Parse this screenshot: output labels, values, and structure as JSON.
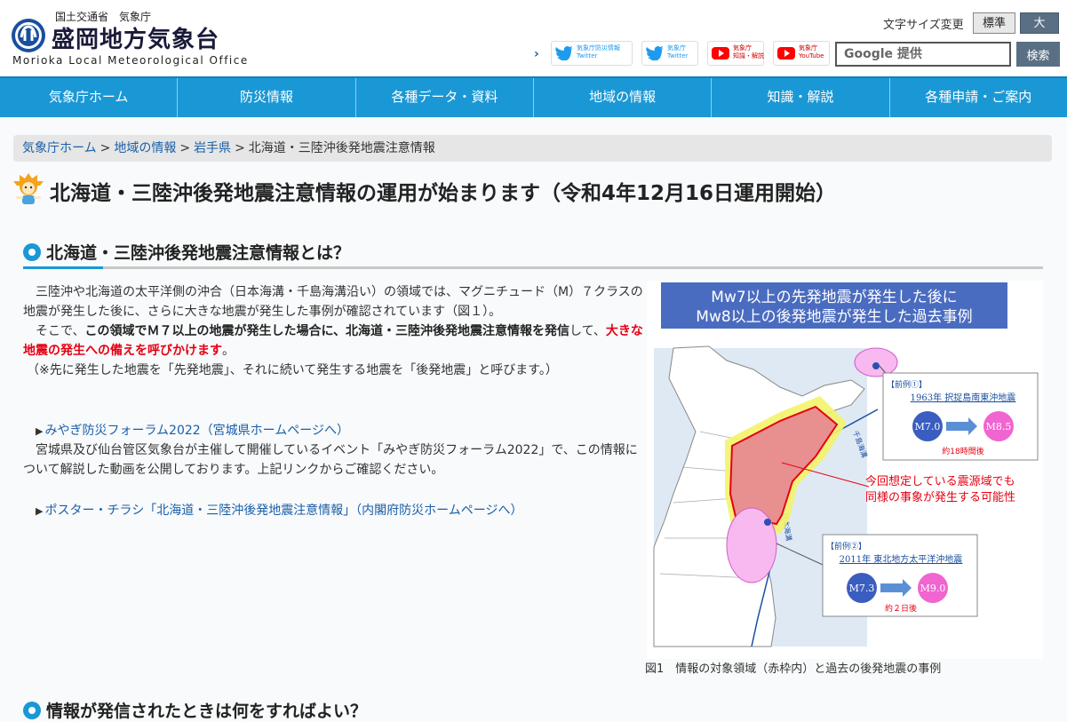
{
  "header": {
    "ministry": "国土交通省　気象庁",
    "office_jp": "盛岡地方気象台",
    "office_en": "Morioka Local Meteorological Office",
    "font_size_label": "文字サイズ変更",
    "font_standard": "標準",
    "font_large": "大",
    "sns": [
      {
        "line1": "気象庁防災情報",
        "line2": "Twitter"
      },
      {
        "line1": "気象庁",
        "line2": "Twitter"
      },
      {
        "line1": "気象庁",
        "line2": "知識・解説"
      },
      {
        "line1": "気象庁",
        "line2": "YouTube"
      }
    ],
    "search_placeholder": "Google 提供",
    "search_button": "検索"
  },
  "nav": [
    "気象庁ホーム",
    "防災情報",
    "各種データ・資料",
    "地域の情報",
    "知識・解説",
    "各種申請・ご案内"
  ],
  "breadcrumb": {
    "items": [
      "気象庁ホーム",
      "地域の情報",
      "岩手県"
    ],
    "separator": ">",
    "current": "北海道・三陸沖後発地震注意情報"
  },
  "page_title": "北海道・三陸沖後発地震注意情報の運用が始まります（令和4年12月16日運用開始）",
  "section1": {
    "title": "北海道・三陸沖後発地震注意情報とは？",
    "p1": "　三陸沖や北海道の太平洋側の沖合（日本海溝・千島海溝沿い）の領域では、マグニチュード（M）７クラスの地震が発生した後に、さらに大きな地震が発生した事例が確認されています（図１）。",
    "p2_pre": "　そこで、",
    "p2_bold1": "この領域でＭ７以上の地震が発生した場合に、北海道・三陸沖後発地震注意情報を発信",
    "p2_mid": "して、",
    "p2_red": "大きな地震の発生への備えを呼びかけます",
    "p2_post": "。",
    "p3": "（※先に発生した地震を「先発地震」、それに続いて発生する地震を「後発地震」と呼びます。）",
    "link1": "みやぎ防災フォーラム2022（宮城県ホームページへ）",
    "p4": "　宮城県及び仙台管区気象台が主催して開催しているイベント「みやぎ防災フォーラム2022」で、この情報について解説した動画を公開しております。上記リンクからご確認ください。",
    "link2": "ポスター・チラシ「北海道・三陸沖後発地震注意情報」（内閣府防災ホームページへ）",
    "link_marker": "▶"
  },
  "figure": {
    "banner_line1": "Mw7以上の先発地震が発生した後に",
    "banner_line2": "Mw8以上の後発地震が発生した過去事例",
    "case1_label": "【前例①】",
    "case1_name": "1963年 択捉島南東沖地震",
    "case1_m1": "M7.0",
    "case1_m2": "M8.5",
    "case1_interval": "約18時間後",
    "case2_label": "【前例②】",
    "case2_name": "2011年 東北地方太平洋沖地震",
    "case2_m1": "M7.3",
    "case2_m2": "M9.0",
    "case2_interval": "約２日後",
    "note_line1": "今回想定している震源域でも",
    "note_line2": "同様の事象が発生する可能性",
    "trench1": "千島海溝",
    "trench2": "日本海溝",
    "caption": "図1　情報の対象領域（赤枠内）と過去の後発地震の事例"
  },
  "section2": {
    "title": "情報が発信されたときは何をすればよい？"
  },
  "colors": {
    "nav_bg": "#1a98d5",
    "accent_red": "#e60012",
    "link": "#1a5fa8",
    "banner": "#4a6cc0"
  }
}
